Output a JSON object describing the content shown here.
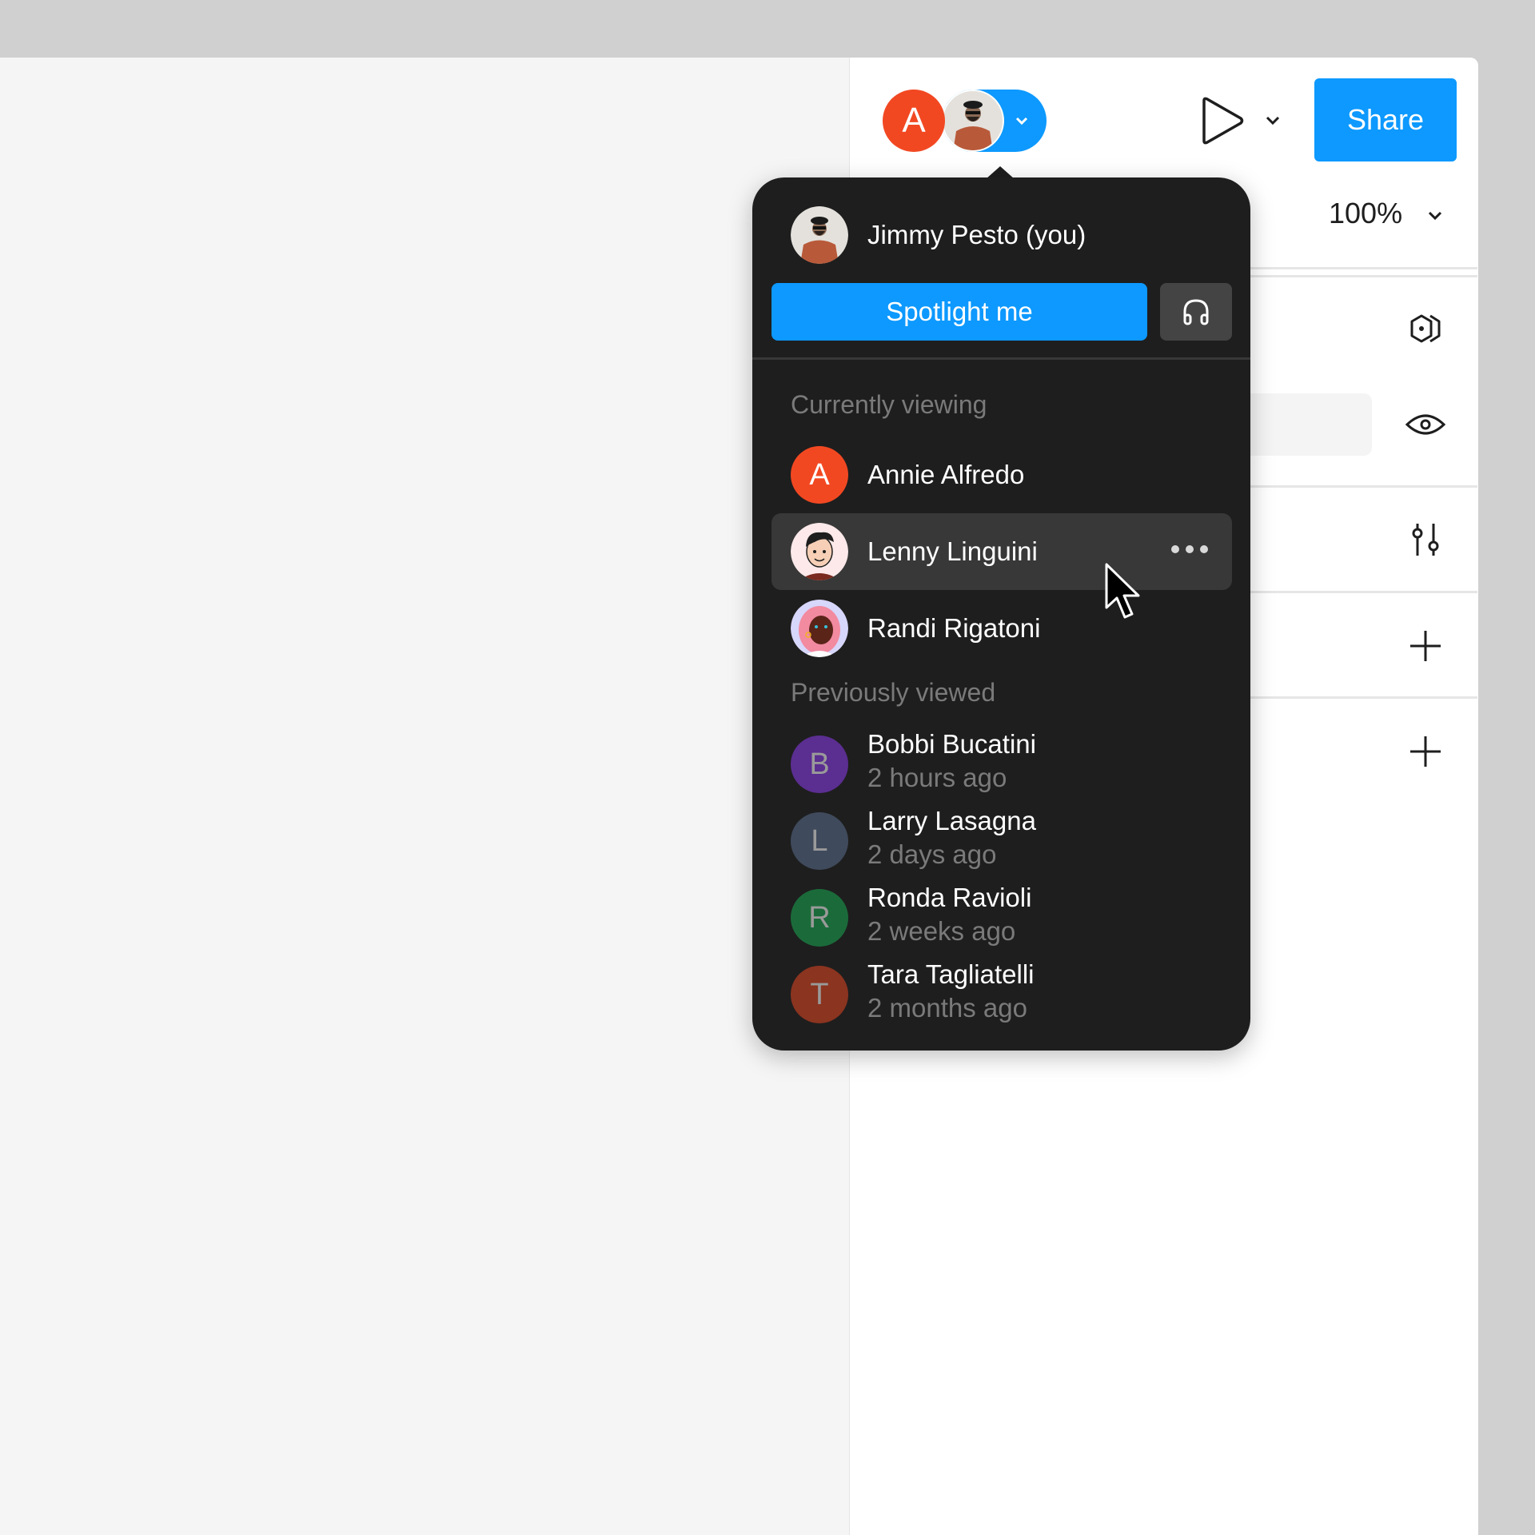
{
  "toolbar": {
    "collaborators": [
      {
        "initial": "A",
        "name": "Annie Alfredo",
        "color": "#f24822"
      },
      {
        "name": "Jimmy Pesto",
        "type": "photo"
      }
    ],
    "share_label": "Share",
    "zoom_level": "100%",
    "accent_color": "#0d99ff"
  },
  "right_panel_icons": [
    "component-icon",
    "eye-icon",
    "sliders-icon",
    "plus-icon",
    "plus-icon"
  ],
  "popup": {
    "me": {
      "name": "Jimmy Pesto (you)"
    },
    "spotlight_label": "Spotlight me",
    "audio_icon": "headphones-icon",
    "currently_viewing_label": "Currently viewing",
    "currently_viewing": [
      {
        "name": "Annie Alfredo",
        "initial": "A",
        "color": "#f24822"
      },
      {
        "name": "Lenny Linguini",
        "avatar": "illustration",
        "hovered": true
      },
      {
        "name": "Randi Rigatoni",
        "avatar": "illustration"
      }
    ],
    "previously_viewed_label": "Previously viewed",
    "previously_viewed": [
      {
        "name": "Bobbi Bucatini",
        "time": "2 hours ago",
        "initial": "B",
        "color": "#5b2e91"
      },
      {
        "name": "Larry Lasagna",
        "time": "2 days ago",
        "initial": "L",
        "color": "#3f4a5c"
      },
      {
        "name": "Ronda Ravioli",
        "time": "2 weeks ago",
        "initial": "R",
        "color": "#1b6b3a"
      },
      {
        "name": "Tara Tagliatelli",
        "time": "2 months ago",
        "initial": "T",
        "color": "#8b3420"
      }
    ]
  }
}
